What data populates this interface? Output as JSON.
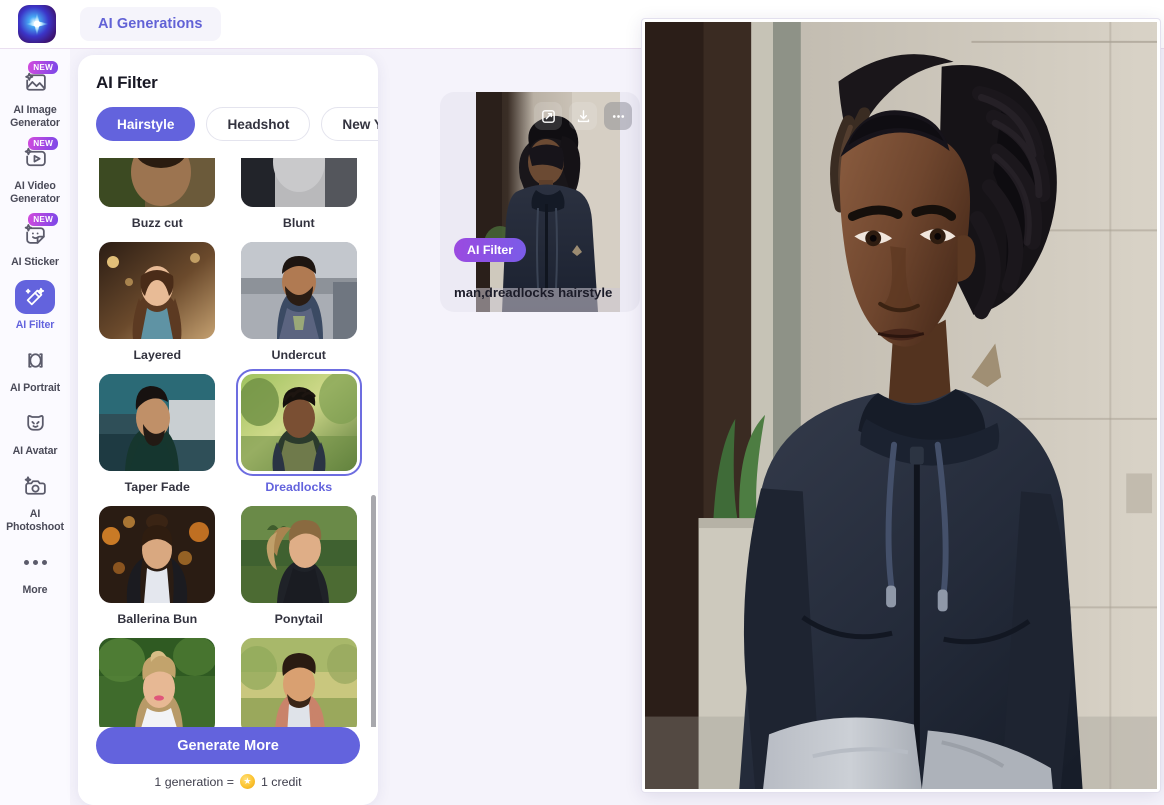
{
  "header": {
    "logo_icon": "sparkle-logo-icon",
    "nav_pill_label": "AI Generations"
  },
  "sidebar": {
    "items": [
      {
        "label": "AI Image Generator",
        "icon": "ai-image-generator-icon",
        "badge": "NEW",
        "active": false
      },
      {
        "label": "AI Video Generator",
        "icon": "ai-video-generator-icon",
        "badge": "NEW",
        "active": false
      },
      {
        "label": "AI Sticker",
        "icon": "ai-sticker-icon",
        "badge": "NEW",
        "active": false
      },
      {
        "label": "AI Filter",
        "icon": "ai-filter-icon",
        "badge": "",
        "active": true
      },
      {
        "label": "AI Portrait",
        "icon": "ai-portrait-icon",
        "badge": "",
        "active": false
      },
      {
        "label": "AI Avatar",
        "icon": "ai-avatar-icon",
        "badge": "",
        "active": false
      },
      {
        "label": "AI Photoshoot",
        "icon": "ai-photoshoot-icon",
        "badge": "",
        "active": false
      },
      {
        "label": "More",
        "icon": "more-dots-icon",
        "badge": "",
        "active": false
      }
    ]
  },
  "panel": {
    "title": "AI Filter",
    "tabs": [
      {
        "label": "Hairstyle",
        "active": true
      },
      {
        "label": "Headshot",
        "active": false
      },
      {
        "label": "New Year",
        "active": false
      }
    ],
    "styles": [
      {
        "label": "Buzz cut",
        "selected": false
      },
      {
        "label": "Blunt",
        "selected": false
      },
      {
        "label": "Layered",
        "selected": false
      },
      {
        "label": "Undercut",
        "selected": false
      },
      {
        "label": "Taper Fade",
        "selected": false
      },
      {
        "label": "Dreadlocks",
        "selected": true
      },
      {
        "label": "Ballerina Bun",
        "selected": false
      },
      {
        "label": "Ponytail",
        "selected": false
      },
      {
        "label": "",
        "selected": false
      },
      {
        "label": "",
        "selected": false
      }
    ],
    "generate_label": "Generate More",
    "credit_prefix": "1 generation =",
    "credit_suffix": "1 credit",
    "scrollbar": "vertical-scrollbar"
  },
  "result_card": {
    "badge_label": "AI Filter",
    "caption": "man,dreadlocks hairstyle",
    "actions": [
      {
        "name": "enhance-icon"
      },
      {
        "name": "download-icon"
      },
      {
        "name": "more-options-icon"
      }
    ]
  },
  "preview": {
    "name": "generated-image-preview"
  },
  "colors": {
    "accent": "#6363dd",
    "badge_gradient_start": "#d24bdd",
    "badge_gradient_end": "#7a47e8",
    "canvas_bg": "#f5f3fb",
    "rail_bg": "#fbfaff"
  }
}
